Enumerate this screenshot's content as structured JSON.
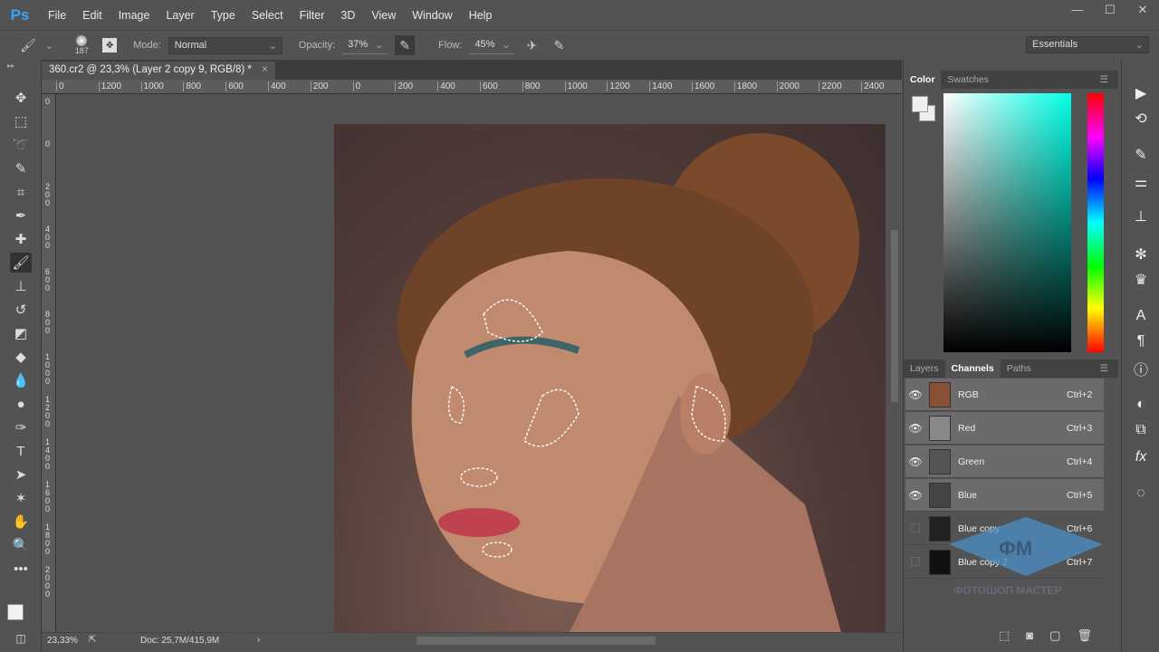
{
  "app": {
    "logo": "Ps"
  },
  "menu": [
    "File",
    "Edit",
    "Image",
    "Layer",
    "Type",
    "Select",
    "Filter",
    "3D",
    "View",
    "Window",
    "Help"
  ],
  "window_controls": [
    "minimize",
    "restore",
    "close"
  ],
  "options": {
    "brush_size": "187",
    "mode_label": "Mode:",
    "mode_value": "Normal",
    "opacity_label": "Opacity:",
    "opacity_value": "37%",
    "flow_label": "Flow:",
    "flow_value": "45%",
    "workspace": "Essentials"
  },
  "document": {
    "tab_title": "360.cr2 @ 23,3% (Layer 2 copy 9, RGB/8) *",
    "close": "×"
  },
  "ruler_h": [
    "0",
    "1200",
    "1000",
    "800",
    "600",
    "400",
    "200",
    "0",
    "200",
    "400",
    "600",
    "800",
    "1000",
    "1200",
    "1400",
    "1600",
    "1800",
    "2000",
    "2200",
    "2400"
  ],
  "ruler_v": [
    "0",
    "0",
    "2 0 0",
    "4 0 0",
    "6 0 0",
    "8 0 0",
    "1 0 0 0",
    "1 2 0 0",
    "1 4 0 0",
    "1 6 0 0",
    "1 8 0 0",
    "2 0 0 0"
  ],
  "status": {
    "zoom": "23,33%",
    "doc": "Doc: 25,7M/415,9M"
  },
  "color_panel": {
    "tabs": [
      "Color",
      "Swatches"
    ],
    "active": "Color",
    "hue_color": "#00ffe6"
  },
  "channels_panel": {
    "tabs": [
      "Layers",
      "Channels",
      "Paths"
    ],
    "active": "Channels",
    "channels": [
      {
        "name": "RGB",
        "shortcut": "Ctrl+2",
        "visible": true
      },
      {
        "name": "Red",
        "shortcut": "Ctrl+3",
        "visible": true
      },
      {
        "name": "Green",
        "shortcut": "Ctrl+4",
        "visible": true
      },
      {
        "name": "Blue",
        "shortcut": "Ctrl+5",
        "visible": true
      },
      {
        "name": "Blue copy",
        "shortcut": "Ctrl+6",
        "visible": false
      },
      {
        "name": "Blue copy 2",
        "shortcut": "Ctrl+7",
        "visible": false
      }
    ]
  },
  "watermark": {
    "text": "ФОТОШОП МАСТЕР",
    "mark": "ФМ"
  }
}
